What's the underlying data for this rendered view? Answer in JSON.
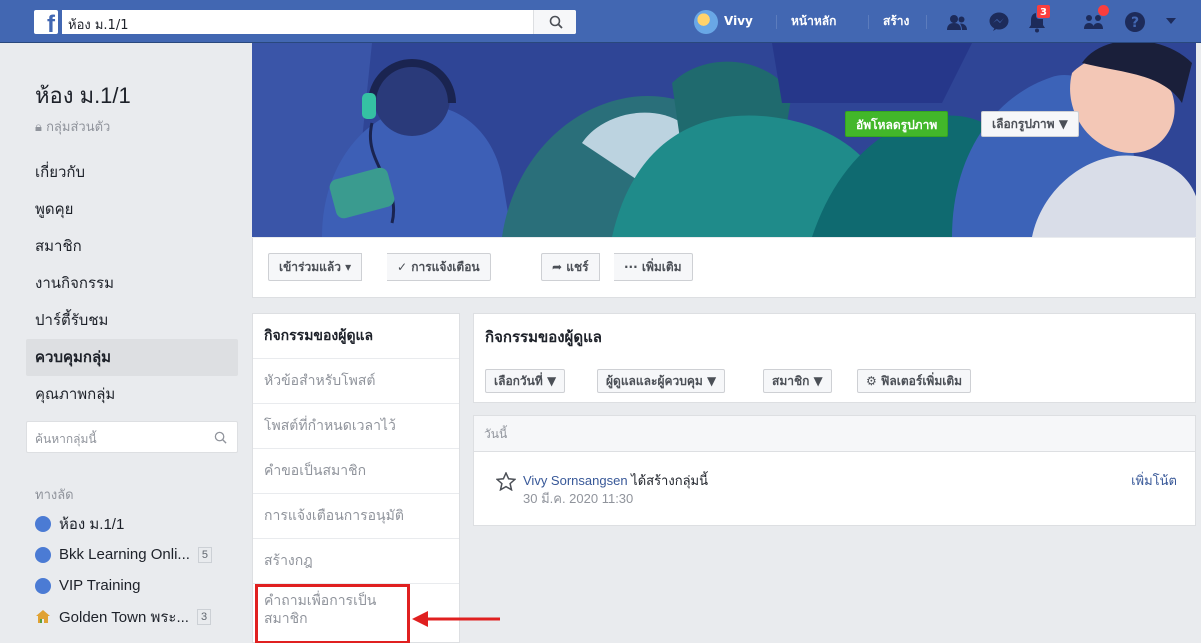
{
  "topbar": {
    "logo": "f",
    "search_value": "ห้อง ม.1/1",
    "user_name": "Vivy",
    "nav_home": "หน้าหลัก",
    "nav_create": "สร้าง",
    "notif_count": "3",
    "accent": "#4267b2"
  },
  "group": {
    "name": "ห้อง ม.1/1",
    "privacy": "กลุ่มส่วนตัว"
  },
  "sidebar": {
    "items": [
      {
        "label": "เกี่ยวกับ"
      },
      {
        "label": "พูดคุย"
      },
      {
        "label": "สมาชิก"
      },
      {
        "label": "งานกิจกรรม"
      },
      {
        "label": "ปาร์ตี้รับชม"
      },
      {
        "label": "ควบคุมกลุ่ม"
      },
      {
        "label": "คุณภาพกลุ่ม"
      }
    ],
    "search_placeholder": "ค้นหากลุ่มนี้",
    "shortcuts_header": "ทางลัด",
    "shortcuts": [
      {
        "label": "ห้อง ม.1/1",
        "count": ""
      },
      {
        "label": "Bkk Learning Onli...",
        "count": "5"
      },
      {
        "label": "VIP Training",
        "count": ""
      },
      {
        "label": "Golden Town พระ...",
        "count": "3"
      }
    ]
  },
  "cover": {
    "upload_label": "อัพโหลดรูปภาพ",
    "select_label": "เลือกรูปภาพ ▼"
  },
  "actions": {
    "joined": "เข้าร่วมแล้ว ▾",
    "notifications": "✓ การแจ้งเตือน",
    "share": "➦ แชร์",
    "more": "··· เพิ่มเติม"
  },
  "admin_nav": {
    "items": [
      {
        "label": "กิจกรรมของผู้ดูแล"
      },
      {
        "label": "หัวข้อสำหรับโพสต์"
      },
      {
        "label": "โพสต์ที่กำหนดเวลาไว้"
      },
      {
        "label": "คำขอเป็นสมาชิก"
      },
      {
        "label": "การแจ้งเตือนการอนุมัติ"
      },
      {
        "label": "สร้างกฎ"
      }
    ],
    "highlight_line1": "คำถามเพื่อการเป็น",
    "highlight_line2": "สมาชิก"
  },
  "activity": {
    "title": "กิจกรรมของผู้ดูแล",
    "filters": [
      {
        "label": "เลือกวันที่ ▼"
      },
      {
        "label": "ผู้ดูแลและผู้ควบคุม ▼"
      },
      {
        "label": "สมาชิก ▼"
      },
      {
        "label": "⚙ ฟิลเตอร์เพิ่มเติม"
      }
    ],
    "day_header": "วันนี้",
    "entry_user": "Vivy Sornsangsen",
    "entry_action": " ได้สร้างกลุ่มนี้",
    "entry_time": "30 มี.ค. 2020 11:30",
    "add_note": "เพิ่มโน้ต"
  }
}
